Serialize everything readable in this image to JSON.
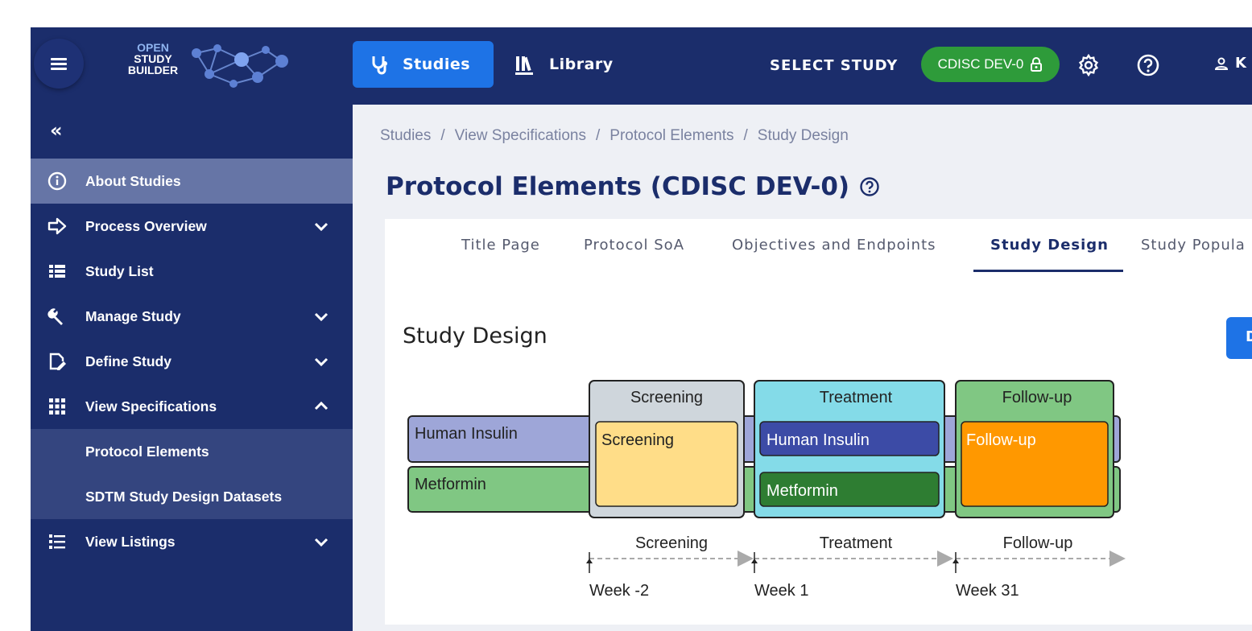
{
  "topbar": {
    "logo": {
      "line1": "OPEN",
      "line2": "STUDY",
      "line3": "BUILDER"
    },
    "studies_label": "Studies",
    "library_label": "Library",
    "select_study_label": "SELECT STUDY",
    "study_chip": "CDISC DEV-0",
    "user_initial": "K"
  },
  "sidebar": {
    "collapse_glyph": "«",
    "items": [
      {
        "label": "About Studies",
        "icon": "info-icon"
      },
      {
        "label": "Process Overview",
        "icon": "arrow-right-icon"
      },
      {
        "label": "Study List",
        "icon": "list-icon"
      },
      {
        "label": "Manage Study",
        "icon": "wrench-icon"
      },
      {
        "label": "Define Study",
        "icon": "file-edit-icon"
      },
      {
        "label": "View Specifications",
        "icon": "grid-icon"
      },
      {
        "label": "Protocol Elements"
      },
      {
        "label": "SDTM Study Design Datasets"
      },
      {
        "label": "View Listings",
        "icon": "list-bulleted-icon"
      }
    ]
  },
  "breadcrumb": [
    "Studies",
    "View Specifications",
    "Protocol Elements",
    "Study Design"
  ],
  "breadcrumb_sep": "/",
  "page_title": "Protocol Elements (CDISC DEV-0)",
  "tabs": [
    "Title Page",
    "Protocol SoA",
    "Objectives and Endpoints",
    "Study Design",
    "Study Popula"
  ],
  "section_title": "Study Design",
  "action_button_partial": "D",
  "design": {
    "epochs": [
      "Screening",
      "Treatment",
      "Follow-up"
    ],
    "arms": [
      "Human Insulin",
      "Metformin"
    ],
    "elements": {
      "screening": "Screening",
      "treat_insulin": "Human Insulin",
      "treat_metformin": "Metformin",
      "followup": "Follow-up"
    },
    "timeline_labels": [
      "Screening",
      "Treatment",
      "Follow-up"
    ],
    "visits": [
      "Week -2",
      "Week 1",
      "Week 31"
    ]
  },
  "colors": {
    "nav_bg": "#1b2d6b",
    "primary": "#1e73e6",
    "chip_green": "#2e9b3a",
    "arm_insulin": "#9ea6d8",
    "arm_metformin": "#80c783",
    "screening_epoch": "#cfd6dc",
    "screening_element": "#ffdd88",
    "treatment_epoch": "#84dbe8",
    "insulin_element": "#3c4ba6",
    "metformin_element": "#2e7d32",
    "followup_epoch": "#80c783",
    "followup_element": "#ff9800"
  }
}
